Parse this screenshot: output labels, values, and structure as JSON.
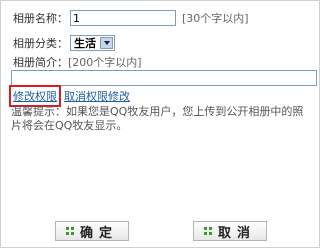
{
  "form": {
    "name_label": "相册名称：",
    "name_value": "1",
    "name_hint": "[30个字以内]",
    "category_label": "相册分类：",
    "category_value": "生活",
    "desc_label": "相册简介：",
    "desc_hint": "[200个字以内]"
  },
  "links": {
    "modify_permission": "修改权限",
    "cancel_permission_modify": "取消权限修改"
  },
  "tip": "温馨提示：如果您是QQ牧友用户，您上传到公开相册中的照片将会在QQ牧友显示。",
  "buttons": {
    "ok": "确定",
    "cancel": "取消"
  },
  "colors": {
    "link": "#1f5fa5",
    "highlight_box": "#d81e1e",
    "button_icon": "#3a9a2a"
  }
}
